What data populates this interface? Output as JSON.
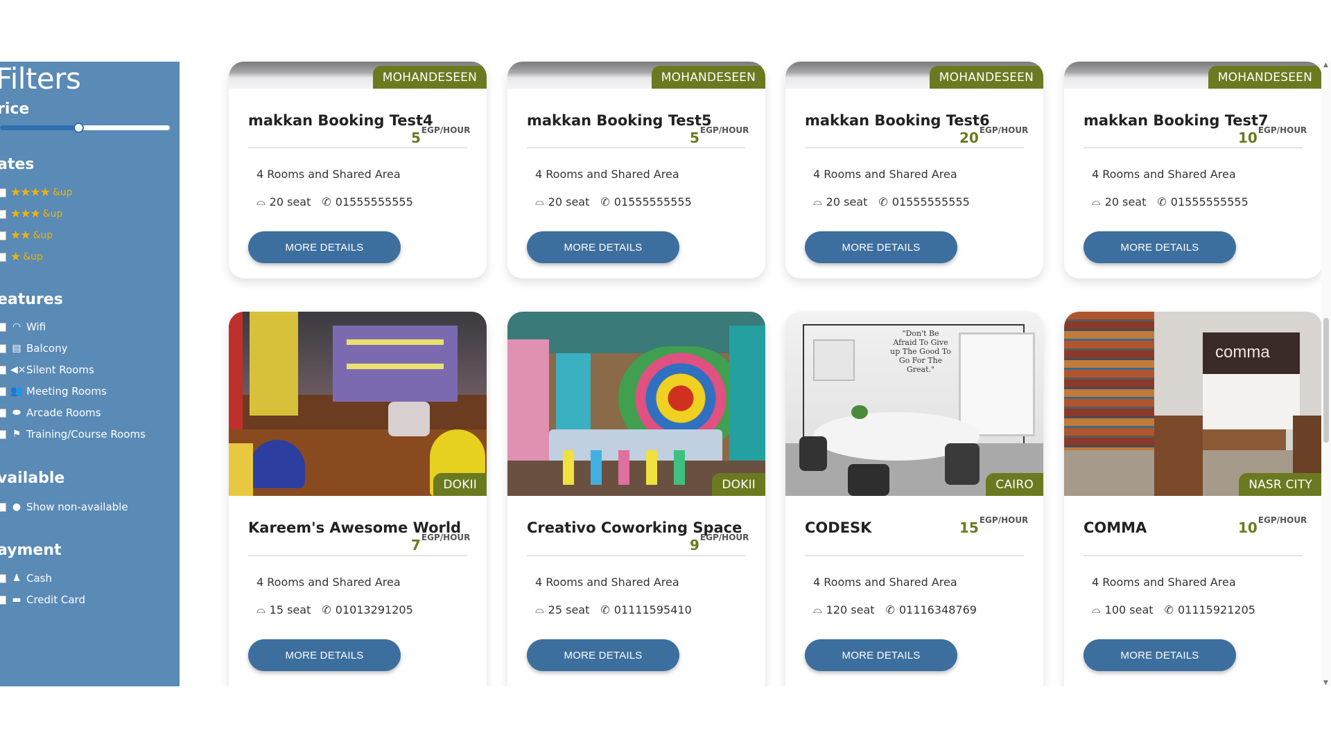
{
  "filters": {
    "title": "Filters",
    "price_heading": "rice",
    "price_level": 0.46,
    "rates_heading": "ates",
    "rates": [
      {
        "stars": "★★★★",
        "label": "&up"
      },
      {
        "stars": "★★★",
        "label": "&up"
      },
      {
        "stars": "★★",
        "label": "&up"
      },
      {
        "stars": "★",
        "label": "&up"
      }
    ],
    "features_heading": "eatures",
    "features": [
      {
        "icon": "wifi-icon",
        "label": "Wifi"
      },
      {
        "icon": "balcony-icon",
        "label": "Balcony"
      },
      {
        "icon": "mute-icon",
        "label": "Silent Rooms"
      },
      {
        "icon": "meeting-icon",
        "label": "Meeting Rooms"
      },
      {
        "icon": "gamepad-icon",
        "label": "Arcade Rooms"
      },
      {
        "icon": "training-icon",
        "label": "Training/Course Rooms"
      }
    ],
    "available_heading": "vailable",
    "available_option": "Show non-available",
    "payment_heading": "ayment",
    "payment": [
      {
        "icon": "cash-icon",
        "label": "Cash"
      },
      {
        "icon": "credit-card-icon",
        "label": "Credit Card"
      }
    ]
  },
  "cards": [
    {
      "name": "makkan Booking Test4",
      "location": "MOHANDESEEN",
      "price": "5",
      "unit": "EGP/HOUR",
      "rooms": "4 Rooms and Shared Area",
      "seats": "20 seat",
      "phone": "01555555555",
      "button": "MORE DETAILS"
    },
    {
      "name": "makkan Booking Test5",
      "location": "MOHANDESEEN",
      "price": "5",
      "unit": "EGP/HOUR",
      "rooms": "4 Rooms and Shared Area",
      "seats": "20 seat",
      "phone": "01555555555",
      "button": "MORE DETAILS"
    },
    {
      "name": "makkan Booking Test6",
      "location": "MOHANDESEEN",
      "price": "20",
      "unit": "EGP/HOUR",
      "rooms": "4 Rooms and Shared Area",
      "seats": "20 seat",
      "phone": "01555555555",
      "button": "MORE DETAILS"
    },
    {
      "name": "makkan Booking Test7",
      "location": "MOHANDESEEN",
      "price": "10",
      "unit": "EGP/HOUR",
      "rooms": "4 Rooms and Shared Area",
      "seats": "20 seat",
      "phone": "01555555555",
      "button": "MORE DETAILS"
    },
    {
      "name": "Kareem's Awesome World",
      "location": "DOKII",
      "price": "7",
      "unit": "EGP/HOUR",
      "rooms": "4 Rooms and Shared Area",
      "seats": "15 seat",
      "phone": "01013291205",
      "button": "MORE DETAILS"
    },
    {
      "name": "Creativo Coworking Space",
      "location": "DOKII",
      "price": "9",
      "unit": "EGP/HOUR",
      "rooms": "4 Rooms and Shared Area",
      "seats": "25 seat",
      "phone": "01111595410",
      "button": "MORE DETAILS"
    },
    {
      "name": "CODESK",
      "location": "CAIRO",
      "price": "15",
      "unit": "EGP/HOUR",
      "rooms": "4 Rooms and Shared Area",
      "seats": "120 seat",
      "phone": "01116348769",
      "button": "MORE DETAILS",
      "photo_text": "\"Don't Be Afraid To Give up The Good To Go For The Great.\""
    },
    {
      "name": "COMMA",
      "location": "NASR CITY",
      "price": "10",
      "unit": "EGP/HOUR",
      "rooms": "4 Rooms and Shared Area",
      "seats": "100 seat",
      "phone": "01115921205",
      "button": "MORE DETAILS",
      "photo_text": "comma"
    }
  ],
  "colors": {
    "sidebar": "#5a8ab6",
    "button": "#3d6f9e",
    "tag": "#6b7a20",
    "star": "#f0b400"
  }
}
